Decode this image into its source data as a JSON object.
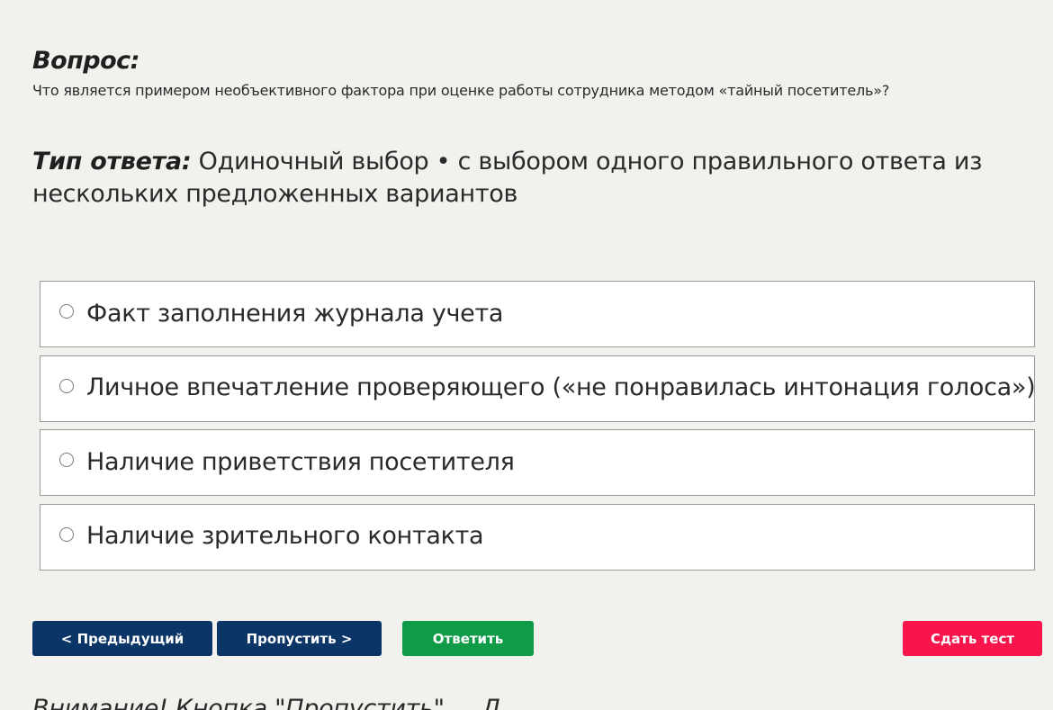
{
  "question": {
    "label": "Вопрос:",
    "text": "Что является примером необъективного фактора при оценке работы сотрудника методом «тайный посетитель»?"
  },
  "answer_type": {
    "label": "Тип ответа:",
    "value": "Одиночный выбор • с выбором одного правильного ответа из нескольких предложенных вариантов"
  },
  "options": [
    {
      "label": "Факт заполнения журнала учета",
      "selected": false
    },
    {
      "label": "Личное впечатление проверяющего («не понравилась интонация голоса»)",
      "selected": false
    },
    {
      "label": "Наличие приветствия посетителя",
      "selected": false
    },
    {
      "label": "Наличие зрительного контакта",
      "selected": false
    }
  ],
  "buttons": {
    "prev_label": "< Предыдущий",
    "skip_label": "Пропустить >",
    "answer_label": "Ответить",
    "submit_label": "Сдать тест"
  },
  "note": {
    "text": "Внимание! Кнопка \"Пропустить\" ... Л"
  },
  "colors": {
    "background": "#f2f1ee",
    "nav_button": "#0b3467",
    "answer_button": "#109c47",
    "submit_button": "#f7154b"
  }
}
